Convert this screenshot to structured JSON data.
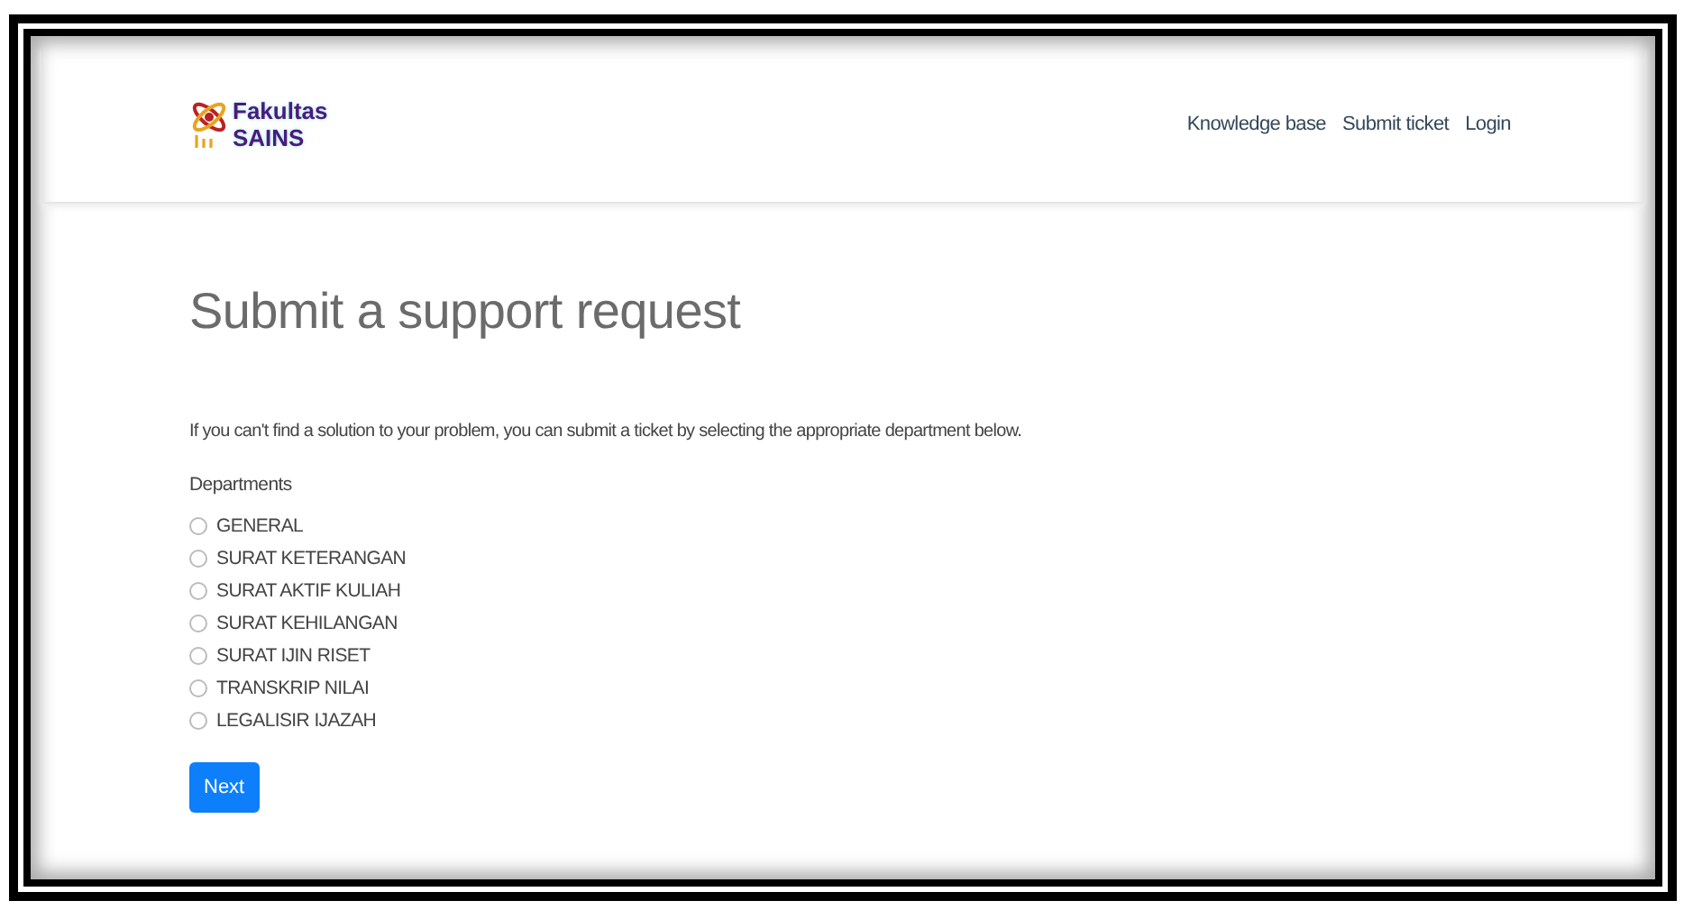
{
  "logo": {
    "line_1": "Fakultas",
    "line_2": "SAINS"
  },
  "nav": [
    "Knowledge base",
    "Submit ticket",
    "Login"
  ],
  "title": "Submit a support request",
  "intro": "If you can't find a solution to your problem, you can submit a ticket by selecting the appropriate department below.",
  "departments": {
    "label": "Departments",
    "options": [
      {
        "label": "GENERAL",
        "selected": false
      },
      {
        "label": "SURAT KETERANGAN",
        "selected": false
      },
      {
        "label": "SURAT AKTIF KULIAH",
        "selected": false
      },
      {
        "label": "SURAT KEHILANGAN",
        "selected": false
      },
      {
        "label": "SURAT IJIN RISET",
        "selected": false
      },
      {
        "label": "TRANSKRIP NILAI",
        "selected": false
      },
      {
        "label": "LEGALISIR IJAZAH",
        "selected": false
      }
    ]
  },
  "button": "Next"
}
